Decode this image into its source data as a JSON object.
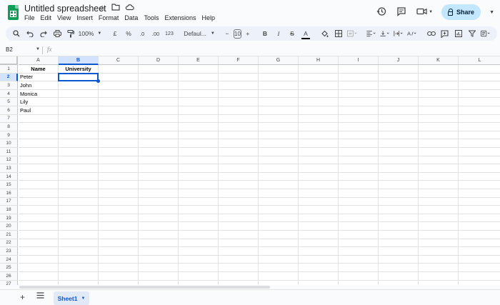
{
  "app": {
    "title": "Untitled spreadsheet",
    "menu": [
      "File",
      "Edit",
      "View",
      "Insert",
      "Format",
      "Data",
      "Tools",
      "Extensions",
      "Help"
    ],
    "share_label": "Share"
  },
  "toolbar": {
    "zoom": "100%",
    "currency": "£",
    "percent": "%",
    "decrease_decimal": ".0",
    "increase_decimal": ".00",
    "number_format": "123",
    "font": "Defaul...",
    "font_size": "10",
    "bold": "B",
    "italic": "I",
    "strike": "S",
    "text_color": "A"
  },
  "formula_bar": {
    "name_box": "B2",
    "fx": "fx",
    "formula": ""
  },
  "grid": {
    "selected_cell": "B2",
    "columns": [
      "A",
      "B",
      "C",
      "D",
      "E",
      "F",
      "G",
      "H",
      "I",
      "J",
      "K",
      "L"
    ],
    "rows": [
      "1",
      "2",
      "3",
      "4",
      "5",
      "6",
      "7",
      "8",
      "9",
      "10",
      "11",
      "12",
      "13",
      "14",
      "15",
      "16",
      "17",
      "18",
      "19",
      "20",
      "21",
      "22",
      "23",
      "24",
      "25",
      "26",
      "27"
    ],
    "cells": {
      "A1": "Name",
      "B1": "University",
      "A2": "Peter",
      "A3": "John",
      "A4": "Monica",
      "A5": "Lily",
      "A6": "Paul"
    }
  },
  "sheets": [
    {
      "name": "Sheet1",
      "active": true
    }
  ],
  "colors": {
    "accent": "#0b57d0",
    "share_bg": "#c2e7ff",
    "sheets_green": "#0f9d58"
  }
}
